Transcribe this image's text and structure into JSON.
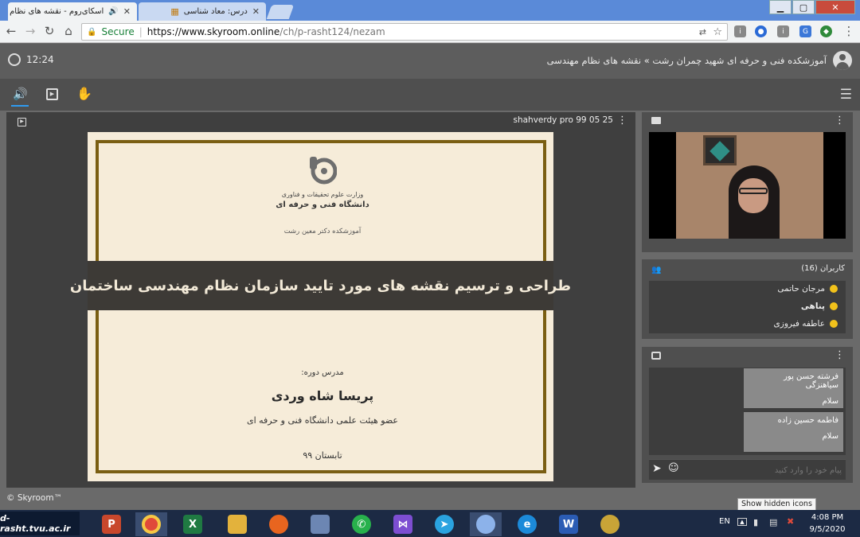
{
  "browser": {
    "tabs": [
      {
        "label": "اسکای‌روم - نقشه های نظام"
      },
      {
        "label": "درس: معاد شناسی"
      }
    ],
    "url_host": "https://www.skyroom.online",
    "url_path": "/ch/p-rasht124/nezam",
    "secure_label": "Secure"
  },
  "app": {
    "time": "12:24",
    "breadcrumb": "آموزشکده فنی و حرفه ای شهید چمران رشت » نقشه های نظام مهندسی"
  },
  "presentation": {
    "name": "shahverdy pro 99 05 25",
    "slide": {
      "ministry": "وزارت علوم تحقیقات و فناوری",
      "university": "دانشگاه فنی و حرفه ای",
      "institute": "آموزشکده دکتر معین رشت",
      "title": "طراحی و ترسیم نقشه های مورد تایید سازمان نظام مهندسی ساختمان",
      "instructor_label": "مدرس دوره:",
      "instructor_name": "پریسا شاه وردی",
      "instructor_role": "عضو هیئت علمی دانشگاه فنی و حرفه ای",
      "term": "تابستان ۹۹"
    }
  },
  "users": {
    "title": "کاربران (16)",
    "items": [
      "مرجان حاتمی",
      "پناهی",
      "عاطفه فیروزی"
    ]
  },
  "chat": {
    "messages": [
      {
        "author": "فرشته حسن پور سیاهنزگی",
        "text": "سلام"
      },
      {
        "author": "فاطمه حسین زاده",
        "text": "سلام"
      }
    ],
    "placeholder": "پیام خود را وارد کنید"
  },
  "footer": "© Skyroom™",
  "taskbar": {
    "watermark": "d-rasht.tvu.ac.ir",
    "tooltip": "Show hidden icons",
    "lang": "EN",
    "time": "4:08 PM",
    "date": "9/5/2020"
  },
  "colors": {
    "frame": "#7a5e12",
    "slide_bg": "#f6ecd9",
    "title_band": "#3d3a36",
    "user_icon": "#f2c21b"
  }
}
